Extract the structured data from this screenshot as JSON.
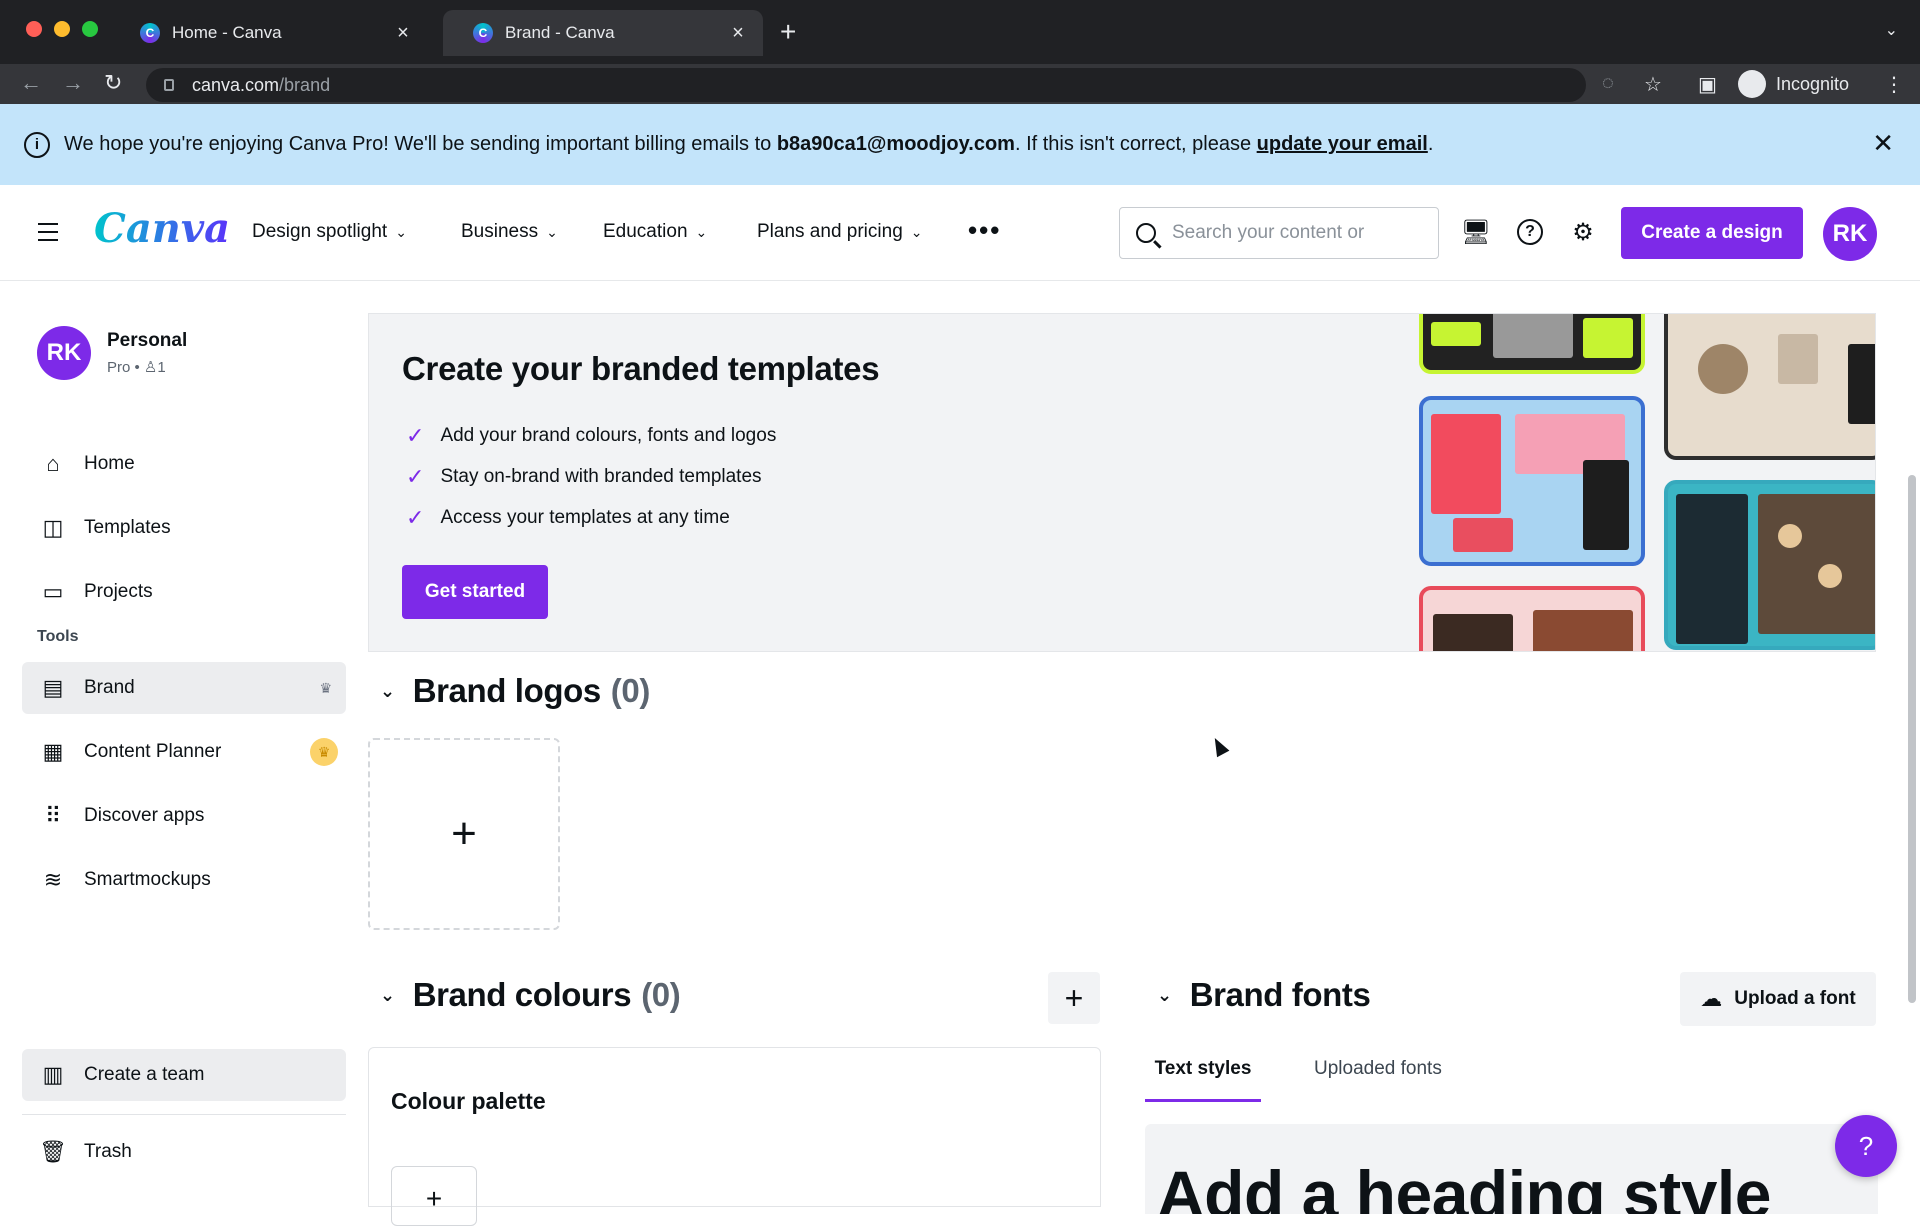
{
  "browser": {
    "tabs": [
      {
        "label": "Home - Canva"
      },
      {
        "label": "Brand - Canva"
      }
    ],
    "url_host": "canva.com",
    "url_path": "/brand",
    "profile_label": "Incognito"
  },
  "banner": {
    "text_before": "We hope you're enjoying Canva Pro! We'll be sending important billing emails to ",
    "email": "b8a90ca1@moodjoy.com",
    "text_after": ". If this isn't correct, please ",
    "link": "update your email",
    "end": "."
  },
  "header": {
    "logo": "Canva",
    "menu": [
      "Design spotlight",
      "Business",
      "Education",
      "Plans and pricing"
    ],
    "search_placeholder": "Search your content or",
    "create_label": "Create a design",
    "avatar_initials": "RK"
  },
  "sidebar": {
    "account": {
      "initials": "RK",
      "name": "Personal",
      "sub": "Pro • ♙1"
    },
    "nav": [
      {
        "label": "Home"
      },
      {
        "label": "Templates"
      },
      {
        "label": "Projects"
      }
    ],
    "tools_heading": "Tools",
    "tools": [
      {
        "label": "Brand"
      },
      {
        "label": "Content Planner"
      },
      {
        "label": "Discover apps"
      },
      {
        "label": "Smartmockups"
      }
    ],
    "create_team": "Create a team",
    "trash": "Trash"
  },
  "hero": {
    "title": "Create your branded templates",
    "checks": [
      "Add your brand colours, fonts and logos",
      "Stay on-brand with branded templates",
      "Access your templates at any time"
    ],
    "button": "Get started"
  },
  "logos": {
    "title": "Brand logos",
    "count": "(0)",
    "add": "+"
  },
  "colours": {
    "title": "Brand colours",
    "count": "(0)",
    "palette_title": "Colour palette",
    "add": "+"
  },
  "fonts": {
    "title": "Brand fonts",
    "upload_label": "Upload a font",
    "tabs": [
      "Text styles",
      "Uploaded fonts"
    ],
    "heading_preview": "Add a heading style"
  },
  "help_fab": "?",
  "colors": {
    "accent": "#7d2ae8",
    "banner": "#c3e4fa",
    "chrome_dark": "#202124"
  }
}
